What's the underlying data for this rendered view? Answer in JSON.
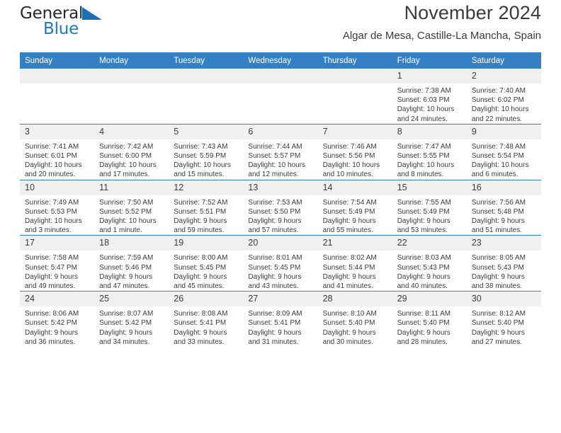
{
  "brand": {
    "name_part1": "General",
    "name_part2": "Blue",
    "triangle_color": "#1c6fb5"
  },
  "header": {
    "title": "November 2024",
    "subtitle": "Algar de Mesa, Castille-La Mancha, Spain"
  },
  "theme": {
    "header_blue": "#3580c4",
    "daynum_gray": "#f0f0f0",
    "text_color": "#3b3b3b",
    "brand_blue": "#1c7bc0"
  },
  "calendar": {
    "weekdays": [
      "Sunday",
      "Monday",
      "Tuesday",
      "Wednesday",
      "Thursday",
      "Friday",
      "Saturday"
    ],
    "weeks": [
      [
        {
          "day": "",
          "sunrise": "",
          "sunset": "",
          "daylight": "",
          "empty": true
        },
        {
          "day": "",
          "sunrise": "",
          "sunset": "",
          "daylight": "",
          "empty": true
        },
        {
          "day": "",
          "sunrise": "",
          "sunset": "",
          "daylight": "",
          "empty": true
        },
        {
          "day": "",
          "sunrise": "",
          "sunset": "",
          "daylight": "",
          "empty": true
        },
        {
          "day": "",
          "sunrise": "",
          "sunset": "",
          "daylight": "",
          "empty": true
        },
        {
          "day": "1",
          "sunrise": "Sunrise: 7:38 AM",
          "sunset": "Sunset: 6:03 PM",
          "daylight": "Daylight: 10 hours and 24 minutes.",
          "empty": false
        },
        {
          "day": "2",
          "sunrise": "Sunrise: 7:40 AM",
          "sunset": "Sunset: 6:02 PM",
          "daylight": "Daylight: 10 hours and 22 minutes.",
          "empty": false
        }
      ],
      [
        {
          "day": "3",
          "sunrise": "Sunrise: 7:41 AM",
          "sunset": "Sunset: 6:01 PM",
          "daylight": "Daylight: 10 hours and 20 minutes.",
          "empty": false
        },
        {
          "day": "4",
          "sunrise": "Sunrise: 7:42 AM",
          "sunset": "Sunset: 6:00 PM",
          "daylight": "Daylight: 10 hours and 17 minutes.",
          "empty": false
        },
        {
          "day": "5",
          "sunrise": "Sunrise: 7:43 AM",
          "sunset": "Sunset: 5:59 PM",
          "daylight": "Daylight: 10 hours and 15 minutes.",
          "empty": false
        },
        {
          "day": "6",
          "sunrise": "Sunrise: 7:44 AM",
          "sunset": "Sunset: 5:57 PM",
          "daylight": "Daylight: 10 hours and 12 minutes.",
          "empty": false
        },
        {
          "day": "7",
          "sunrise": "Sunrise: 7:46 AM",
          "sunset": "Sunset: 5:56 PM",
          "daylight": "Daylight: 10 hours and 10 minutes.",
          "empty": false
        },
        {
          "day": "8",
          "sunrise": "Sunrise: 7:47 AM",
          "sunset": "Sunset: 5:55 PM",
          "daylight": "Daylight: 10 hours and 8 minutes.",
          "empty": false
        },
        {
          "day": "9",
          "sunrise": "Sunrise: 7:48 AM",
          "sunset": "Sunset: 5:54 PM",
          "daylight": "Daylight: 10 hours and 6 minutes.",
          "empty": false
        }
      ],
      [
        {
          "day": "10",
          "sunrise": "Sunrise: 7:49 AM",
          "sunset": "Sunset: 5:53 PM",
          "daylight": "Daylight: 10 hours and 3 minutes.",
          "empty": false
        },
        {
          "day": "11",
          "sunrise": "Sunrise: 7:50 AM",
          "sunset": "Sunset: 5:52 PM",
          "daylight": "Daylight: 10 hours and 1 minute.",
          "empty": false
        },
        {
          "day": "12",
          "sunrise": "Sunrise: 7:52 AM",
          "sunset": "Sunset: 5:51 PM",
          "daylight": "Daylight: 9 hours and 59 minutes.",
          "empty": false
        },
        {
          "day": "13",
          "sunrise": "Sunrise: 7:53 AM",
          "sunset": "Sunset: 5:50 PM",
          "daylight": "Daylight: 9 hours and 57 minutes.",
          "empty": false
        },
        {
          "day": "14",
          "sunrise": "Sunrise: 7:54 AM",
          "sunset": "Sunset: 5:49 PM",
          "daylight": "Daylight: 9 hours and 55 minutes.",
          "empty": false
        },
        {
          "day": "15",
          "sunrise": "Sunrise: 7:55 AM",
          "sunset": "Sunset: 5:49 PM",
          "daylight": "Daylight: 9 hours and 53 minutes.",
          "empty": false
        },
        {
          "day": "16",
          "sunrise": "Sunrise: 7:56 AM",
          "sunset": "Sunset: 5:48 PM",
          "daylight": "Daylight: 9 hours and 51 minutes.",
          "empty": false
        }
      ],
      [
        {
          "day": "17",
          "sunrise": "Sunrise: 7:58 AM",
          "sunset": "Sunset: 5:47 PM",
          "daylight": "Daylight: 9 hours and 49 minutes.",
          "empty": false
        },
        {
          "day": "18",
          "sunrise": "Sunrise: 7:59 AM",
          "sunset": "Sunset: 5:46 PM",
          "daylight": "Daylight: 9 hours and 47 minutes.",
          "empty": false
        },
        {
          "day": "19",
          "sunrise": "Sunrise: 8:00 AM",
          "sunset": "Sunset: 5:45 PM",
          "daylight": "Daylight: 9 hours and 45 minutes.",
          "empty": false
        },
        {
          "day": "20",
          "sunrise": "Sunrise: 8:01 AM",
          "sunset": "Sunset: 5:45 PM",
          "daylight": "Daylight: 9 hours and 43 minutes.",
          "empty": false
        },
        {
          "day": "21",
          "sunrise": "Sunrise: 8:02 AM",
          "sunset": "Sunset: 5:44 PM",
          "daylight": "Daylight: 9 hours and 41 minutes.",
          "empty": false
        },
        {
          "day": "22",
          "sunrise": "Sunrise: 8:03 AM",
          "sunset": "Sunset: 5:43 PM",
          "daylight": "Daylight: 9 hours and 40 minutes.",
          "empty": false
        },
        {
          "day": "23",
          "sunrise": "Sunrise: 8:05 AM",
          "sunset": "Sunset: 5:43 PM",
          "daylight": "Daylight: 9 hours and 38 minutes.",
          "empty": false
        }
      ],
      [
        {
          "day": "24",
          "sunrise": "Sunrise: 8:06 AM",
          "sunset": "Sunset: 5:42 PM",
          "daylight": "Daylight: 9 hours and 36 minutes.",
          "empty": false
        },
        {
          "day": "25",
          "sunrise": "Sunrise: 8:07 AM",
          "sunset": "Sunset: 5:42 PM",
          "daylight": "Daylight: 9 hours and 34 minutes.",
          "empty": false
        },
        {
          "day": "26",
          "sunrise": "Sunrise: 8:08 AM",
          "sunset": "Sunset: 5:41 PM",
          "daylight": "Daylight: 9 hours and 33 minutes.",
          "empty": false
        },
        {
          "day": "27",
          "sunrise": "Sunrise: 8:09 AM",
          "sunset": "Sunset: 5:41 PM",
          "daylight": "Daylight: 9 hours and 31 minutes.",
          "empty": false
        },
        {
          "day": "28",
          "sunrise": "Sunrise: 8:10 AM",
          "sunset": "Sunset: 5:40 PM",
          "daylight": "Daylight: 9 hours and 30 minutes.",
          "empty": false
        },
        {
          "day": "29",
          "sunrise": "Sunrise: 8:11 AM",
          "sunset": "Sunset: 5:40 PM",
          "daylight": "Daylight: 9 hours and 28 minutes.",
          "empty": false
        },
        {
          "day": "30",
          "sunrise": "Sunrise: 8:12 AM",
          "sunset": "Sunset: 5:40 PM",
          "daylight": "Daylight: 9 hours and 27 minutes.",
          "empty": false
        }
      ]
    ]
  }
}
